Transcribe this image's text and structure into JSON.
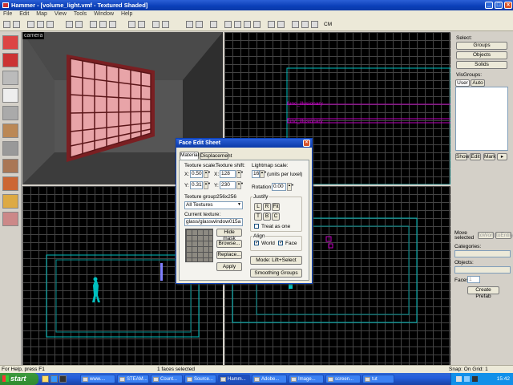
{
  "window": {
    "title": "Hammer - [volume_light.vmf - Textured Shaded]"
  },
  "menu": [
    "File",
    "Edit",
    "Map",
    "View",
    "Tools",
    "Window",
    "Help"
  ],
  "toolbar": {
    "cm_label": "CM"
  },
  "viewport_camera": {
    "label": "camera"
  },
  "viewport_topright": {
    "entity_label_1": "func_illusionary",
    "entity_label_2": "func_illusionary"
  },
  "right_panel": {
    "select_label": "Select:",
    "groups": "Groups",
    "objects": "Objects",
    "solids": "Solids",
    "visgroups_label": "VisGroups:",
    "tab_user": "User",
    "tab_auto": "Auto",
    "show": "Show",
    "edit": "Edit",
    "mark": "Mark",
    "move_selected": "Move selected",
    "to_world": "toWorld",
    "to_entity": "toEntity",
    "categories_label": "Categories:",
    "objects_label": "Objects:",
    "faces_label": "Faces:",
    "faces_value": "1",
    "create_prefab": "Create Prefab"
  },
  "dialog": {
    "title": "Face Edit Sheet",
    "tab_material": "Material",
    "tab_displacement": "Displacement",
    "texture_scale_label": "Texture scale:",
    "texture_shift_label": "Texture shift:",
    "lightmap_scale_label": "Lightmap scale:",
    "scale_x": "0.50",
    "scale_y": "0.31",
    "shift_x": "128",
    "shift_y": "230",
    "lightmap_value": "16",
    "lightmap_units": "(units per luxel)",
    "rotation_label": "Rotation:",
    "rotation_value": "0.00",
    "x_label": "X:",
    "y_label": "Y:",
    "texture_group_label": "Texture group:",
    "texture_size": "256x256",
    "texture_group_value": "All Textures",
    "current_texture_label": "Current texture:",
    "current_texture_value": "glass/glasswindow015a",
    "hide_mask": "Hide mask",
    "browse": "Browse...",
    "replace": "Replace...",
    "apply": "Apply",
    "justify_label": "Justify",
    "j_l": "L",
    "j_r": "R",
    "j_fit": "Fit",
    "j_t": "T",
    "j_b": "B",
    "j_c": "C",
    "treat_as_one": "Treat as one",
    "align_label": "Align",
    "align_world": "World",
    "align_face": "Face",
    "mode": "Mode: Lift+Select",
    "smoothing_groups": "Smoothing Groups"
  },
  "status": {
    "help": "For Help, press F1",
    "selection": "1 faces selected",
    "snap": "Snap: On Grid: 1"
  },
  "taskbar": {
    "start": "start",
    "tasks": [
      "www....",
      "STEAM...",
      "Count...",
      "Source...",
      "Hamm...",
      "Adobe...",
      "Image...",
      "screen...",
      "tut"
    ],
    "clock": "15:42"
  },
  "colors": {
    "xp_blue": "#0a3fb8",
    "grid": "#444444",
    "selection_cyan": "#00c0c0",
    "entity_magenta": "#c000c0",
    "texture_pink": "#e8a4a8"
  }
}
